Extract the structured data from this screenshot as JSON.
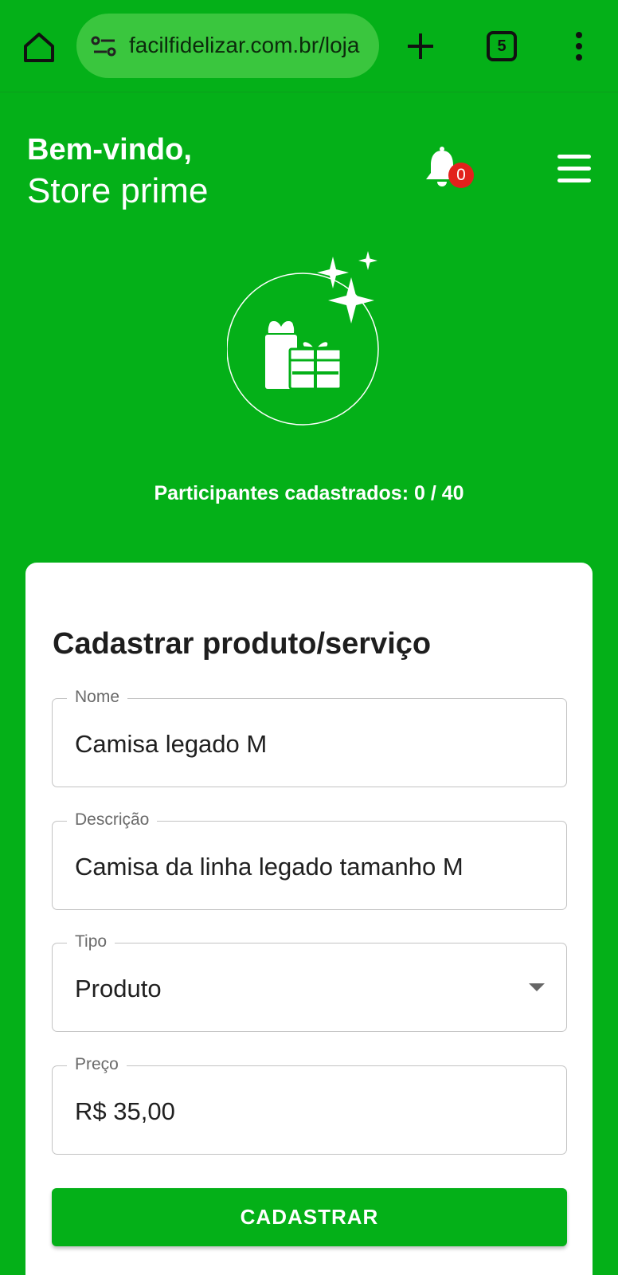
{
  "browser": {
    "url": "facilfidelizar.com.br/loja",
    "tab_count": "5",
    "icons": [
      "home-icon",
      "site-settings-icon",
      "new-tab-icon",
      "tabs-icon",
      "more-vert-icon"
    ]
  },
  "header": {
    "greeting": "Bem-vindo,",
    "store_name": "Store prime",
    "notification_count": "0",
    "icons": [
      "bell-icon",
      "menu-icon"
    ]
  },
  "hero": {
    "icon": "gift-sparkles-icon"
  },
  "participants": {
    "label": "Participantes cadastrados: ",
    "current": "0",
    "separator": " / ",
    "max": "40"
  },
  "form": {
    "title": "Cadastrar produto/serviço",
    "fields": {
      "nome": {
        "label": "Nome",
        "value": "Camisa legado M"
      },
      "descricao": {
        "label": "Descrição",
        "value": "Camisa da linha legado tamanho M"
      },
      "tipo": {
        "label": "Tipo",
        "value": "Produto"
      },
      "preco": {
        "label": "Preço",
        "value": "R$ 35,00"
      }
    },
    "submit_label": "CADASTRAR"
  },
  "colors": {
    "brand_green": "#04b018",
    "url_bar": "#3ac63e",
    "badge_red": "#e2211c",
    "card": "#ffffff"
  }
}
